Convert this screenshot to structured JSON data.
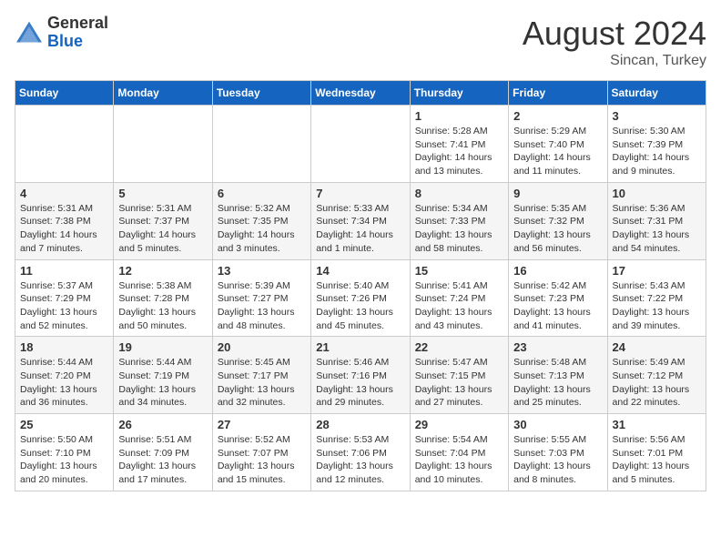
{
  "header": {
    "logo_general": "General",
    "logo_blue": "Blue",
    "month_year": "August 2024",
    "location": "Sincan, Turkey"
  },
  "days_of_week": [
    "Sunday",
    "Monday",
    "Tuesday",
    "Wednesday",
    "Thursday",
    "Friday",
    "Saturday"
  ],
  "weeks": [
    [
      {
        "day": "",
        "detail": ""
      },
      {
        "day": "",
        "detail": ""
      },
      {
        "day": "",
        "detail": ""
      },
      {
        "day": "",
        "detail": ""
      },
      {
        "day": "1",
        "detail": "Sunrise: 5:28 AM\nSunset: 7:41 PM\nDaylight: 14 hours\nand 13 minutes."
      },
      {
        "day": "2",
        "detail": "Sunrise: 5:29 AM\nSunset: 7:40 PM\nDaylight: 14 hours\nand 11 minutes."
      },
      {
        "day": "3",
        "detail": "Sunrise: 5:30 AM\nSunset: 7:39 PM\nDaylight: 14 hours\nand 9 minutes."
      }
    ],
    [
      {
        "day": "4",
        "detail": "Sunrise: 5:31 AM\nSunset: 7:38 PM\nDaylight: 14 hours\nand 7 minutes."
      },
      {
        "day": "5",
        "detail": "Sunrise: 5:31 AM\nSunset: 7:37 PM\nDaylight: 14 hours\nand 5 minutes."
      },
      {
        "day": "6",
        "detail": "Sunrise: 5:32 AM\nSunset: 7:35 PM\nDaylight: 14 hours\nand 3 minutes."
      },
      {
        "day": "7",
        "detail": "Sunrise: 5:33 AM\nSunset: 7:34 PM\nDaylight: 14 hours\nand 1 minute."
      },
      {
        "day": "8",
        "detail": "Sunrise: 5:34 AM\nSunset: 7:33 PM\nDaylight: 13 hours\nand 58 minutes."
      },
      {
        "day": "9",
        "detail": "Sunrise: 5:35 AM\nSunset: 7:32 PM\nDaylight: 13 hours\nand 56 minutes."
      },
      {
        "day": "10",
        "detail": "Sunrise: 5:36 AM\nSunset: 7:31 PM\nDaylight: 13 hours\nand 54 minutes."
      }
    ],
    [
      {
        "day": "11",
        "detail": "Sunrise: 5:37 AM\nSunset: 7:29 PM\nDaylight: 13 hours\nand 52 minutes."
      },
      {
        "day": "12",
        "detail": "Sunrise: 5:38 AM\nSunset: 7:28 PM\nDaylight: 13 hours\nand 50 minutes."
      },
      {
        "day": "13",
        "detail": "Sunrise: 5:39 AM\nSunset: 7:27 PM\nDaylight: 13 hours\nand 48 minutes."
      },
      {
        "day": "14",
        "detail": "Sunrise: 5:40 AM\nSunset: 7:26 PM\nDaylight: 13 hours\nand 45 minutes."
      },
      {
        "day": "15",
        "detail": "Sunrise: 5:41 AM\nSunset: 7:24 PM\nDaylight: 13 hours\nand 43 minutes."
      },
      {
        "day": "16",
        "detail": "Sunrise: 5:42 AM\nSunset: 7:23 PM\nDaylight: 13 hours\nand 41 minutes."
      },
      {
        "day": "17",
        "detail": "Sunrise: 5:43 AM\nSunset: 7:22 PM\nDaylight: 13 hours\nand 39 minutes."
      }
    ],
    [
      {
        "day": "18",
        "detail": "Sunrise: 5:44 AM\nSunset: 7:20 PM\nDaylight: 13 hours\nand 36 minutes."
      },
      {
        "day": "19",
        "detail": "Sunrise: 5:44 AM\nSunset: 7:19 PM\nDaylight: 13 hours\nand 34 minutes."
      },
      {
        "day": "20",
        "detail": "Sunrise: 5:45 AM\nSunset: 7:17 PM\nDaylight: 13 hours\nand 32 minutes."
      },
      {
        "day": "21",
        "detail": "Sunrise: 5:46 AM\nSunset: 7:16 PM\nDaylight: 13 hours\nand 29 minutes."
      },
      {
        "day": "22",
        "detail": "Sunrise: 5:47 AM\nSunset: 7:15 PM\nDaylight: 13 hours\nand 27 minutes."
      },
      {
        "day": "23",
        "detail": "Sunrise: 5:48 AM\nSunset: 7:13 PM\nDaylight: 13 hours\nand 25 minutes."
      },
      {
        "day": "24",
        "detail": "Sunrise: 5:49 AM\nSunset: 7:12 PM\nDaylight: 13 hours\nand 22 minutes."
      }
    ],
    [
      {
        "day": "25",
        "detail": "Sunrise: 5:50 AM\nSunset: 7:10 PM\nDaylight: 13 hours\nand 20 minutes."
      },
      {
        "day": "26",
        "detail": "Sunrise: 5:51 AM\nSunset: 7:09 PM\nDaylight: 13 hours\nand 17 minutes."
      },
      {
        "day": "27",
        "detail": "Sunrise: 5:52 AM\nSunset: 7:07 PM\nDaylight: 13 hours\nand 15 minutes."
      },
      {
        "day": "28",
        "detail": "Sunrise: 5:53 AM\nSunset: 7:06 PM\nDaylight: 13 hours\nand 12 minutes."
      },
      {
        "day": "29",
        "detail": "Sunrise: 5:54 AM\nSunset: 7:04 PM\nDaylight: 13 hours\nand 10 minutes."
      },
      {
        "day": "30",
        "detail": "Sunrise: 5:55 AM\nSunset: 7:03 PM\nDaylight: 13 hours\nand 8 minutes."
      },
      {
        "day": "31",
        "detail": "Sunrise: 5:56 AM\nSunset: 7:01 PM\nDaylight: 13 hours\nand 5 minutes."
      }
    ]
  ]
}
